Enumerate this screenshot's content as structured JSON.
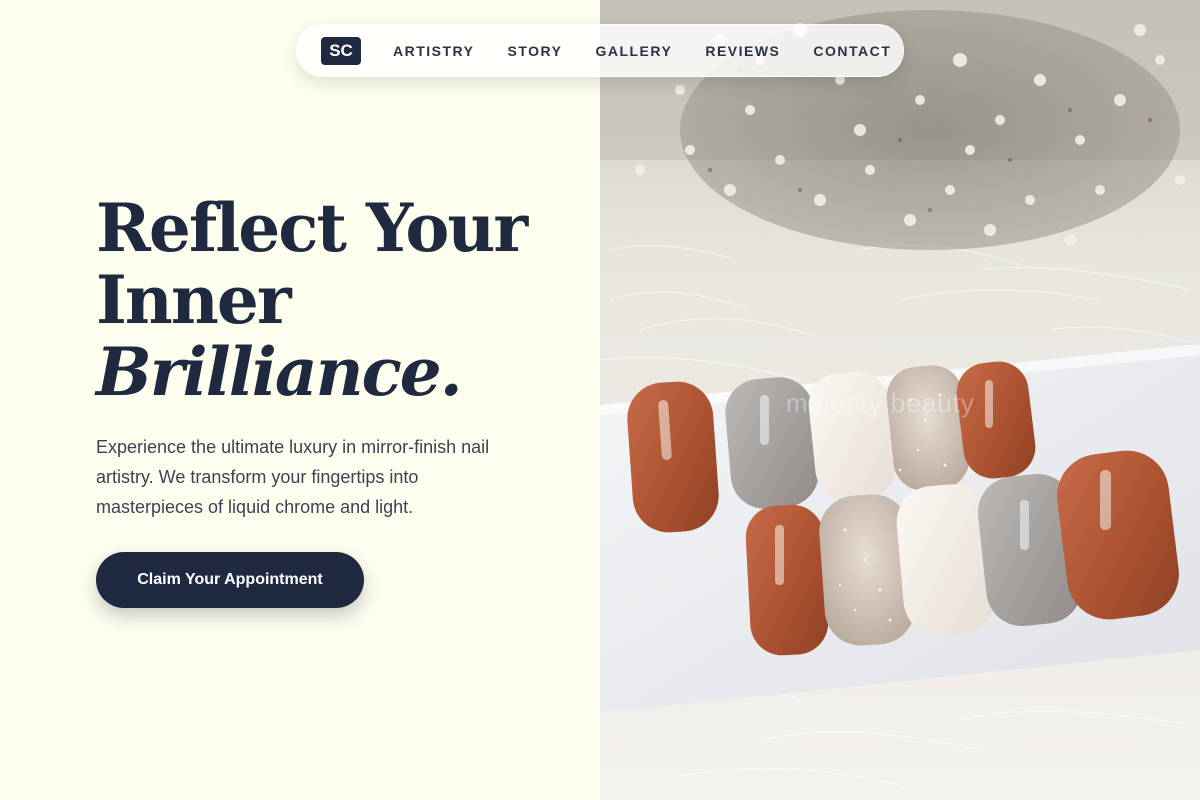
{
  "nav": {
    "logo": "SC",
    "links": [
      "ARTISTRY",
      "STORY",
      "GALLERY",
      "REVIEWS",
      "CONTACT"
    ]
  },
  "hero": {
    "title_line1": "Reflect Your",
    "title_line2": "Inner",
    "title_line3": "Brilliance.",
    "description": "Experience the ultimate luxury in mirror-finish nail artistry. We transform your fingertips into masterpieces of liquid chrome and light.",
    "cta_label": "Claim Your Appointment"
  },
  "image": {
    "subject": "press-on-nails-photo",
    "watermark": "majesty beauty"
  },
  "colors": {
    "background": "#fefeef",
    "navy": "#1f2a40",
    "terracotta": "#b5593a",
    "taupe": "#a8a5a3",
    "cream": "#f2ede6"
  }
}
